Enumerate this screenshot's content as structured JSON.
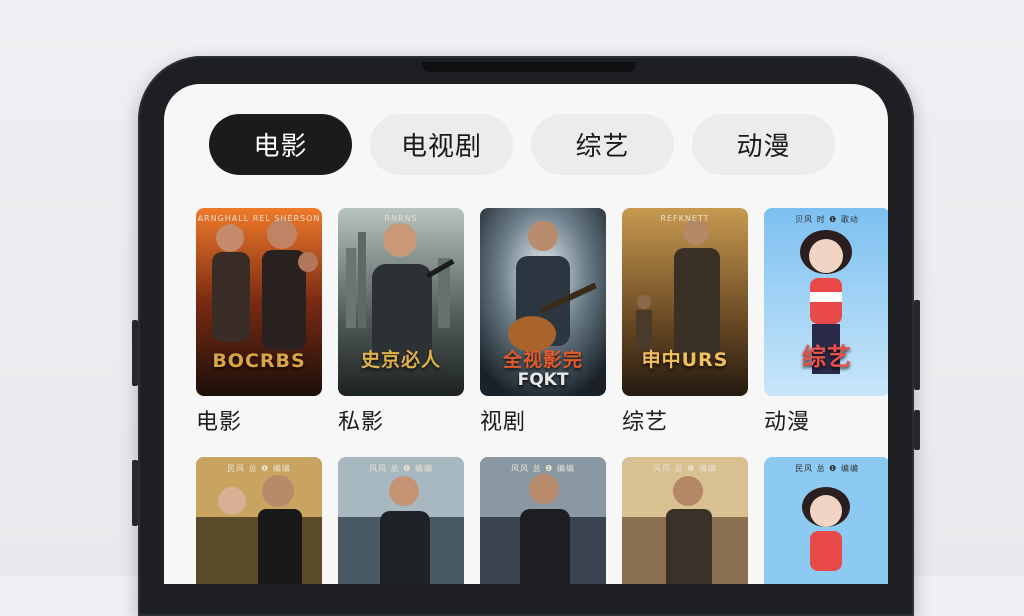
{
  "tabs": [
    {
      "label": "电影",
      "active": true
    },
    {
      "label": "电视剧",
      "active": false
    },
    {
      "label": "综艺",
      "active": false
    },
    {
      "label": "动漫",
      "active": false
    }
  ],
  "row1": [
    {
      "label": "电影",
      "poster_title": "BOCRBS",
      "poster_sub": "",
      "poster_top": "ARNGHALL REL SHERSON",
      "title_color": "#d9a545"
    },
    {
      "label": "私影",
      "poster_title": "史京必人",
      "poster_sub": "",
      "poster_top": "RNRNS",
      "title_color": "#e0b04a"
    },
    {
      "label": "视剧",
      "poster_title": "全视影完",
      "poster_sub": "FQKT",
      "poster_top": "",
      "title_color": "#e05a2a"
    },
    {
      "label": "综艺",
      "poster_title": "申中URS",
      "poster_sub": "",
      "poster_top": "REFKNETT",
      "title_color": "#f0c060"
    },
    {
      "label": "动漫",
      "poster_title": "综艺",
      "poster_sub": "",
      "poster_top": "贝风 时 ❶ 歌动",
      "title_color": "#e8504a"
    }
  ],
  "row2": [
    {
      "poster_top": "民风 总 ❶ 编编"
    },
    {
      "poster_top": "风风 总 ❶ 编编"
    },
    {
      "poster_top": "风风 总 ❶ 编编"
    },
    {
      "poster_top": "风风 总 ❶ 编编"
    },
    {
      "poster_top": "民风 总 ❶ 编编"
    }
  ]
}
